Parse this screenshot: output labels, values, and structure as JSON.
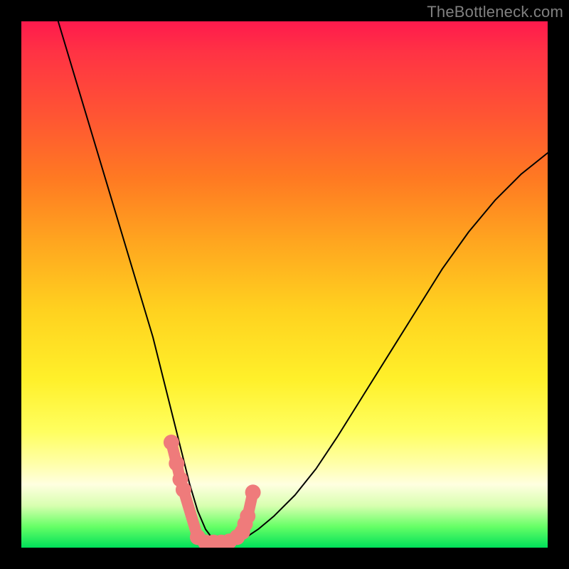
{
  "watermark": "TheBottleneck.com",
  "chart_data": {
    "type": "line",
    "title": "",
    "xlabel": "",
    "ylabel": "",
    "xlim": [
      0,
      100
    ],
    "ylim": [
      0,
      100
    ],
    "grid": false,
    "legend": false,
    "series": [
      {
        "name": "bottleneck-curve",
        "stroke": "#000000",
        "x": [
          7,
          10,
          13,
          16,
          19,
          22,
          25,
          27,
          29,
          30.5,
          32,
          33.5,
          35,
          36.5,
          38,
          40,
          42,
          45,
          48,
          52,
          56,
          60,
          65,
          70,
          75,
          80,
          85,
          90,
          95,
          100
        ],
        "values": [
          100,
          90,
          80,
          70,
          60,
          50,
          40,
          32,
          24,
          18,
          12,
          7,
          3.5,
          1.5,
          0.5,
          0.5,
          1.5,
          3.5,
          6,
          10,
          15,
          21,
          29,
          37,
          45,
          53,
          60,
          66,
          71,
          75
        ]
      },
      {
        "name": "highlight-points",
        "stroke": "#ef7b7b",
        "marker": "circle",
        "x": [
          28.5,
          29.5,
          30.2,
          30.8,
          33.5,
          35,
          36.5,
          38,
          39.5,
          41,
          42,
          42.5,
          43,
          44
        ],
        "values": [
          20,
          16,
          13,
          11,
          2,
          1,
          1,
          1,
          1.2,
          2,
          3,
          4.5,
          6,
          10.5
        ]
      }
    ]
  }
}
